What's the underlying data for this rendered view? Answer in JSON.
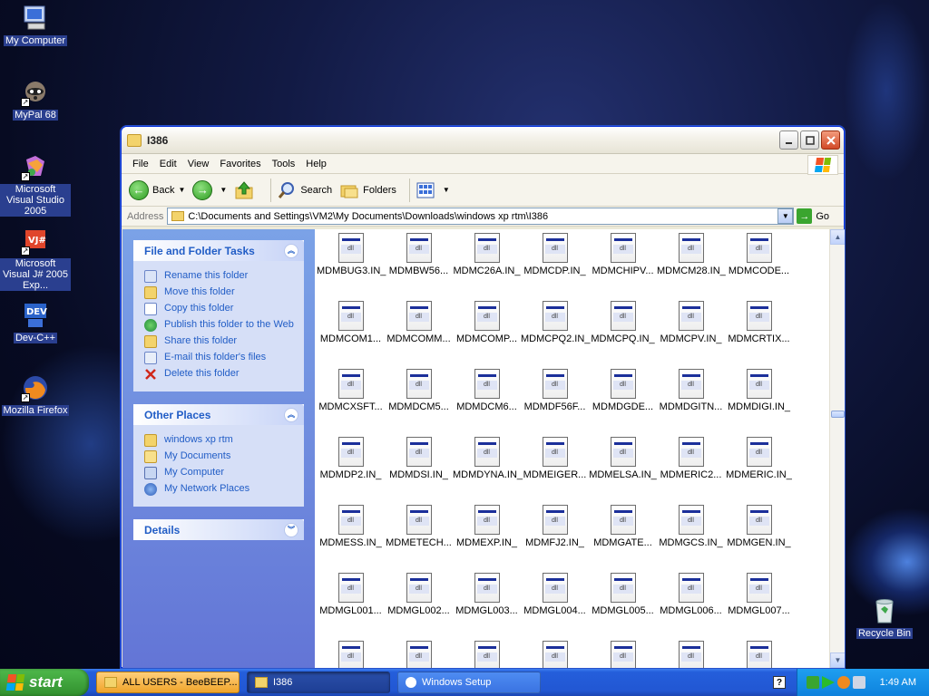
{
  "desktop": {
    "icons": [
      {
        "label": "My Computer"
      },
      {
        "label": "MyPal 68"
      },
      {
        "label": "Microsoft Visual Studio 2005"
      },
      {
        "label": "Microsoft Visual J# 2005 Exp..."
      },
      {
        "label": "Dev-C++"
      },
      {
        "label": "Mozilla Firefox"
      },
      {
        "label": "Recycle Bin"
      }
    ]
  },
  "window": {
    "title": "I386",
    "menu": [
      "File",
      "Edit",
      "View",
      "Favorites",
      "Tools",
      "Help"
    ],
    "toolbar": {
      "back": "Back",
      "search": "Search",
      "folders": "Folders"
    },
    "address": {
      "label": "Address",
      "value": "C:\\Documents and Settings\\VM2\\My Documents\\Downloads\\windows xp rtm\\I386",
      "go": "Go"
    },
    "tasks": {
      "title": "File and Folder Tasks",
      "items": [
        "Rename this folder",
        "Move this folder",
        "Copy this folder",
        "Publish this folder to the Web",
        "Share this folder",
        "E-mail this folder's files",
        "Delete this folder"
      ]
    },
    "other_places": {
      "title": "Other Places",
      "items": [
        "windows xp rtm",
        "My Documents",
        "My Computer",
        "My Network Places"
      ]
    },
    "details": {
      "title": "Details"
    },
    "files": [
      "MDMBUG3.IN_",
      "MDMBW56...",
      "MDMC26A.IN_",
      "MDMCDP.IN_",
      "MDMCHIPV...",
      "MDMCM28.IN_",
      "MDMCODE...",
      "MDMCOM1...",
      "MDMCOMM...",
      "MDMCOMP...",
      "MDMCPQ2.IN_",
      "MDMCPQ.IN_",
      "MDMCPV.IN_",
      "MDMCRTIX...",
      "MDMCXSFT...",
      "MDMDCM5...",
      "MDMDCM6...",
      "MDMDF56F...",
      "MDMDGDE...",
      "MDMDGITN...",
      "MDMDIGI.IN_",
      "MDMDP2.IN_",
      "MDMDSI.IN_",
      "MDMDYNA.IN_",
      "MDMEIGER...",
      "MDMELSA.IN_",
      "MDMERIC2...",
      "MDMERIC.IN_",
      "MDMESS.IN_",
      "MDMETECH...",
      "MDMEXP.IN_",
      "MDMFJ2.IN_",
      "MDMGATE...",
      "MDMGCS.IN_",
      "MDMGEN.IN_",
      "MDMGL001...",
      "MDMGL002...",
      "MDMGL003...",
      "MDMGL004...",
      "MDMGL005...",
      "MDMGL006...",
      "MDMGL007...",
      "",
      "",
      "",
      "",
      "",
      "",
      ""
    ]
  },
  "taskbar": {
    "start": "start",
    "buttons": [
      "ALL USERS - BeeBEEP...",
      "I386",
      "Windows Setup"
    ],
    "clock": "1:49 AM"
  }
}
